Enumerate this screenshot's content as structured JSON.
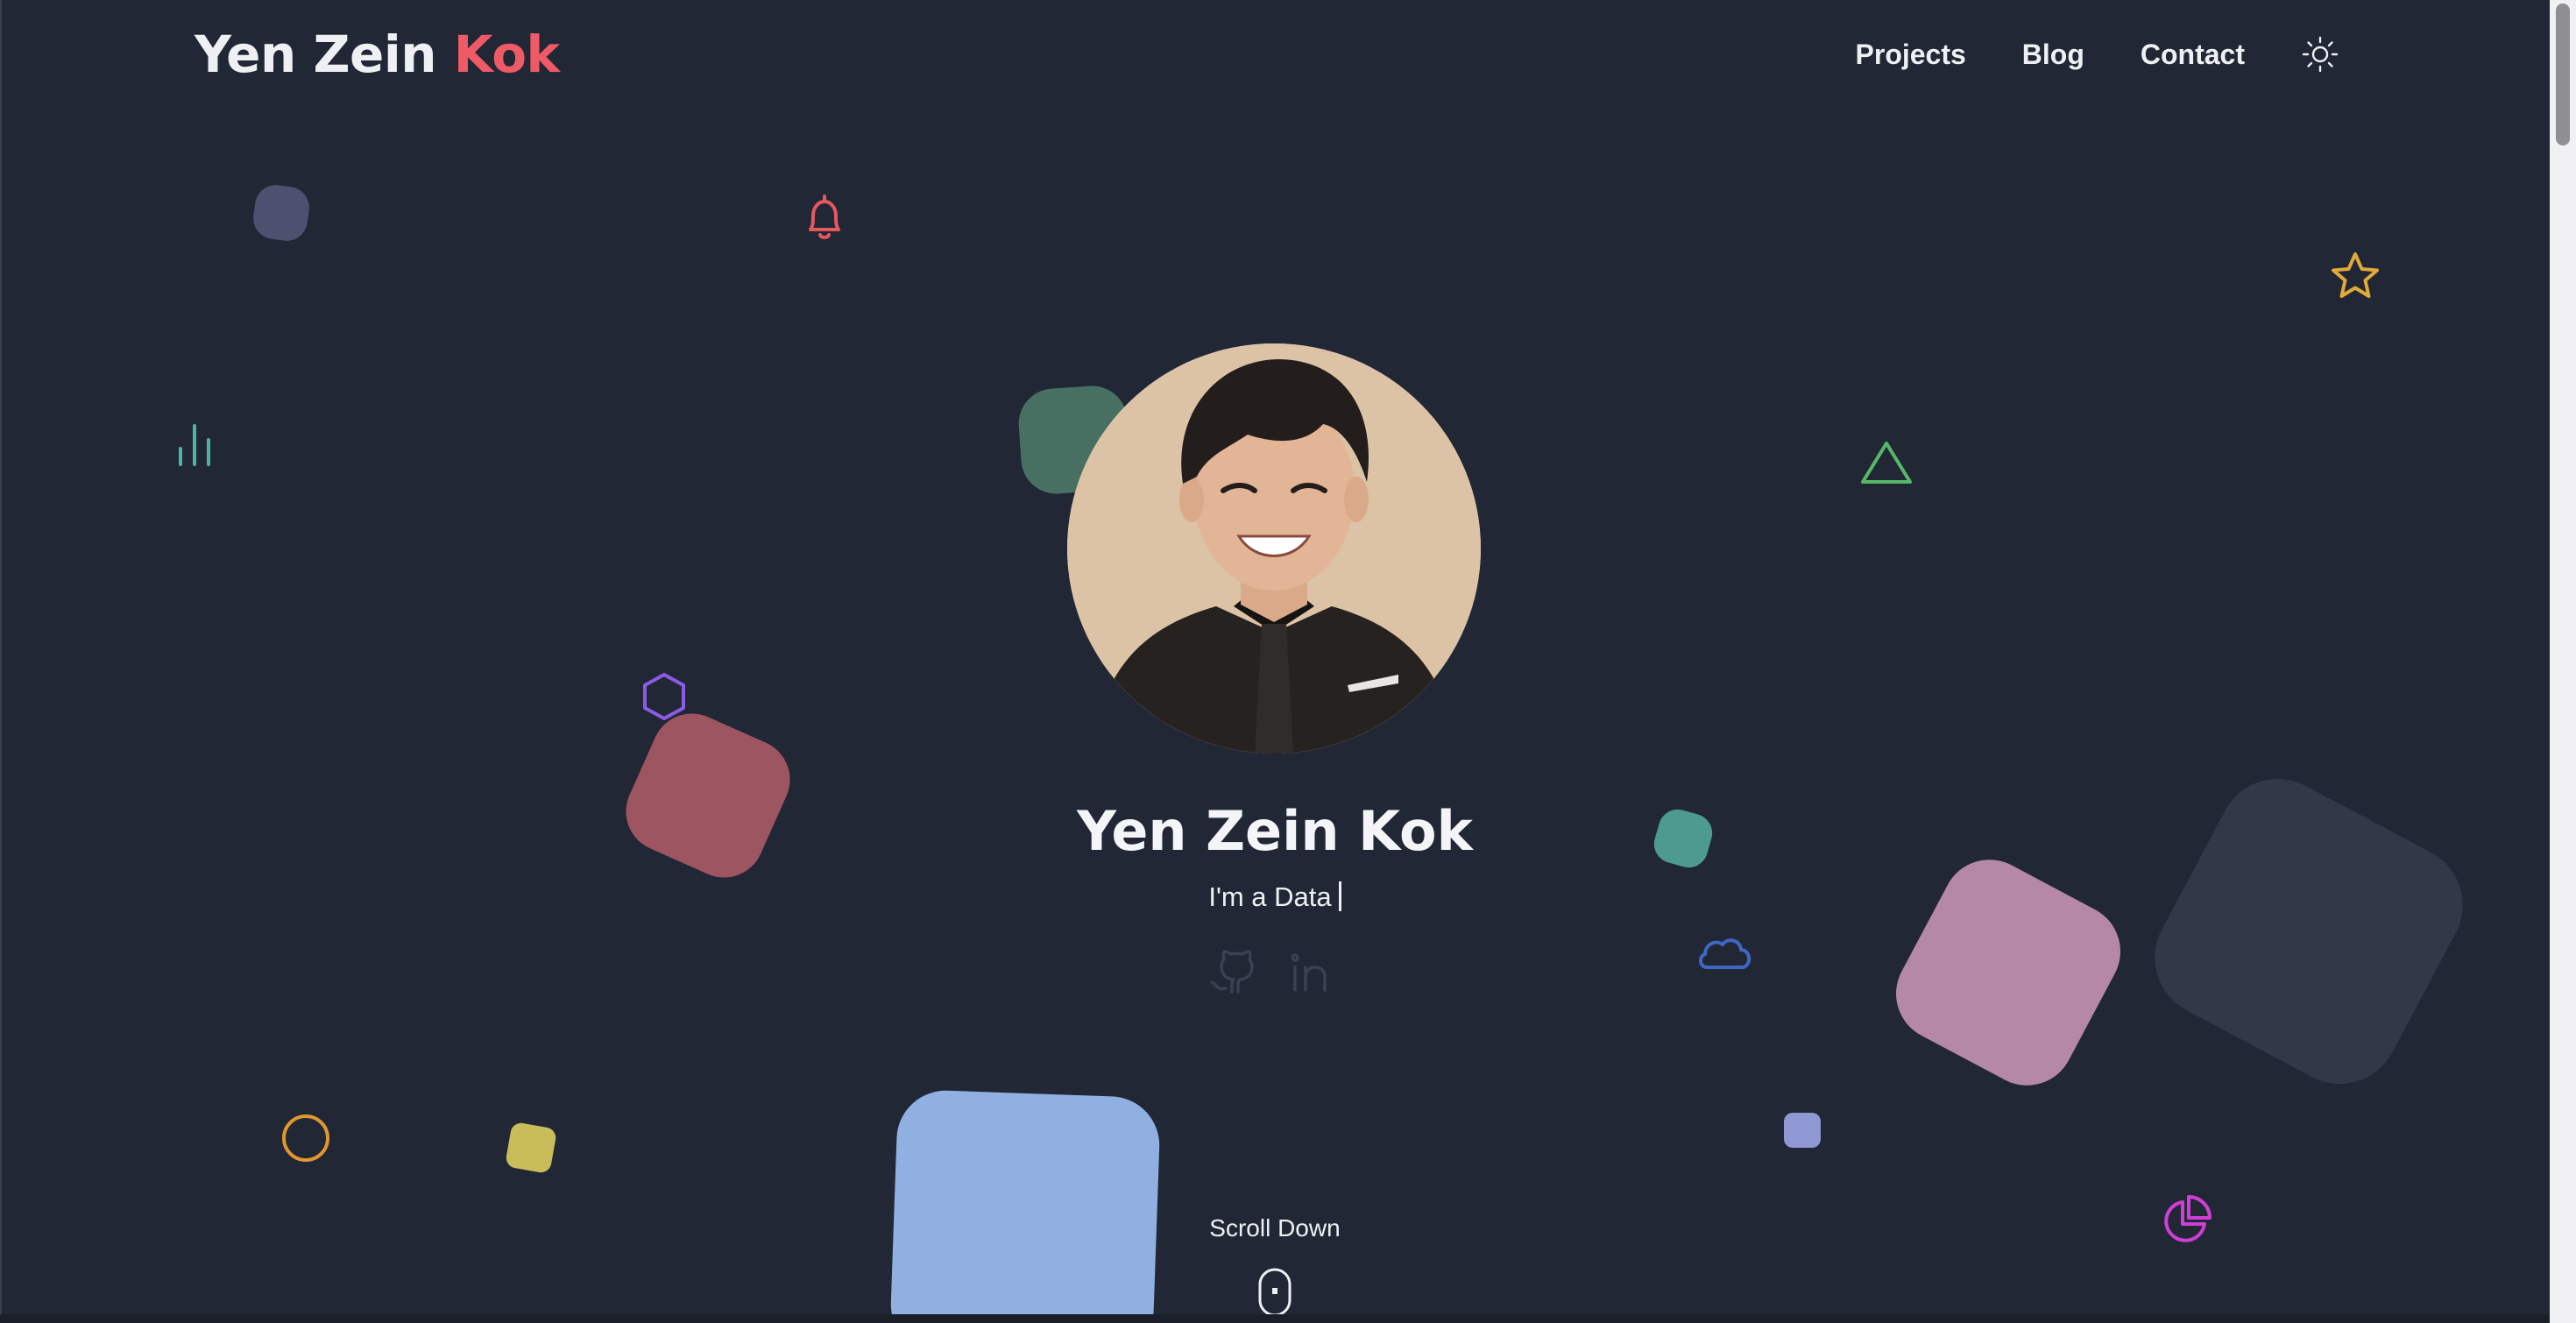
{
  "header": {
    "logo_first": "Yen Zein ",
    "logo_accent": "Kok",
    "nav": {
      "projects": "Projects",
      "blog": "Blog",
      "contact": "Contact"
    },
    "theme_icon": "sun-icon"
  },
  "hero": {
    "name": "Yen Zein Kok",
    "role_text": "I'm a Data",
    "socials": [
      "github-icon",
      "linkedin-icon"
    ],
    "scroll_label": "Scroll Down"
  },
  "colors": {
    "background": "#212735",
    "accent": "#ef5a67",
    "text": "#eef0f4"
  }
}
